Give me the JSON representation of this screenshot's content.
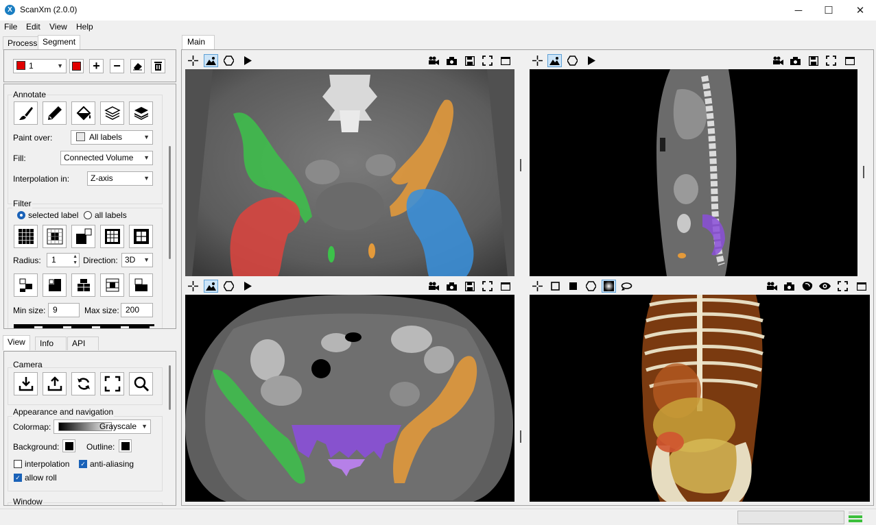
{
  "window": {
    "title": "ScanXm (2.0.0)",
    "app_icon_letter": "X"
  },
  "menu": [
    "File",
    "Edit",
    "View",
    "Help"
  ],
  "top_tabs": [
    "Process",
    "Segment"
  ],
  "label_select": {
    "value": "1",
    "color": "#e00000"
  },
  "annotate": {
    "title": "Annotate",
    "paint_over_label": "Paint over:",
    "paint_over_value": "All labels",
    "fill_label": "Fill:",
    "fill_value": "Connected Volume",
    "interp_label": "Interpolation in:",
    "interp_value": "Z-axis"
  },
  "filter": {
    "title": "Filter",
    "selected_label": "selected label",
    "all_labels": "all labels",
    "radius_label": "Radius:",
    "radius_value": "1",
    "direction_label": "Direction:",
    "direction_value": "3D",
    "min_size_label": "Min size:",
    "min_size_value": "9",
    "max_size_label": "Max size:",
    "max_size_value": "200"
  },
  "bottom_tabs": [
    "View",
    "Info",
    "API"
  ],
  "camera": {
    "title": "Camera"
  },
  "appearance": {
    "title": "Appearance and navigation",
    "colormap_label": "Colormap:",
    "colormap_value": "Grayscale",
    "background_label": "Background:",
    "outline_label": "Outline:",
    "interpolation_label": "interpolation",
    "antialiasing_label": "anti-aliasing",
    "allow_roll_label": "allow roll"
  },
  "window_group": {
    "title": "Window"
  },
  "main_tab": "Main",
  "colors": {
    "red": "#d9443f",
    "green": "#3cc24a",
    "orange": "#e49a3a",
    "blue": "#3a8fd9",
    "purple": "#8a4fd8"
  }
}
